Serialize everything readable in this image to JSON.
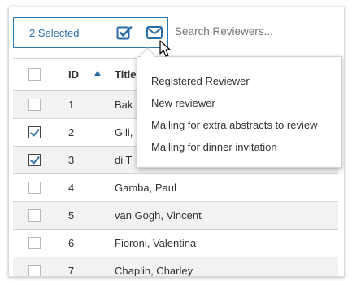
{
  "toolbar": {
    "selected_label": "2 Selected",
    "search_placeholder": "Search Reviewers..."
  },
  "table": {
    "headers": {
      "id": "ID",
      "title": "Title"
    },
    "rows": [
      {
        "id": "1",
        "name": "Bak",
        "checked": false
      },
      {
        "id": "2",
        "name": "Gili,",
        "checked": true
      },
      {
        "id": "3",
        "name": "di T",
        "checked": true
      },
      {
        "id": "4",
        "name": "Gamba, Paul",
        "checked": false
      },
      {
        "id": "5",
        "name": "van Gogh, Vincent",
        "checked": false
      },
      {
        "id": "6",
        "name": "Fioroni, Valentina",
        "checked": false
      },
      {
        "id": "7",
        "name": "Chaplin, Charley",
        "checked": false
      }
    ]
  },
  "mail_menu": {
    "items": [
      "Registered Reviewer",
      "New reviewer",
      "Mailing for extra abstracts to review",
      "Mailing for dinner invitation"
    ]
  },
  "icons": {
    "check_all": "checkbox-checked-icon",
    "mail": "envelope-icon",
    "cursor": "mouse-pointer-icon"
  },
  "colors": {
    "accent": "#2a6ea8",
    "selection_border": "#2a7ab8",
    "stripe": "#f2f2f2"
  }
}
